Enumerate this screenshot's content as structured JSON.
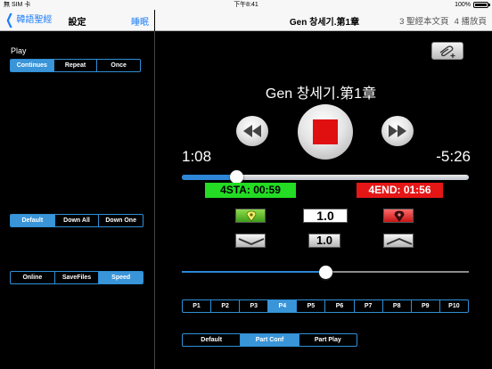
{
  "status_bar": {
    "carrier": "無 SIM 卡",
    "time": "下午8:41",
    "battery": "100%"
  },
  "nav_left": {
    "back_label": "韓語聖經",
    "title": "設定",
    "sleep_label": "睡眠"
  },
  "nav_right": {
    "title": "Gen 창세기.第1章",
    "item_text": "3 聖經本文頁",
    "item_play": "4 播放頁"
  },
  "settings": {
    "play_label": "Play",
    "play_modes": [
      "Continues",
      "Repeat",
      "Once"
    ],
    "play_selected": 0,
    "download_modes": [
      "Default",
      "Down All",
      "Down One"
    ],
    "download_selected": 0,
    "source_modes": [
      "Online",
      "SaveFiles",
      "Speed"
    ],
    "source_selected": 2
  },
  "player": {
    "song_title": "Gen 창세기.第1章",
    "elapsed": "1:08",
    "remaining": "-5:26",
    "progress_fraction": 0.19,
    "ab_start": "4STA: 00:59",
    "ab_end": "4END: 01:56",
    "rate_display": "1.0",
    "rate_button": "1.0",
    "volume_fraction": 0.5,
    "parts": [
      "P1",
      "P2",
      "P3",
      "P4",
      "P5",
      "P6",
      "P7",
      "P8",
      "P9",
      "P10"
    ],
    "part_selected": 3,
    "part_modes": [
      "Default",
      "Part Conf",
      "Part Play"
    ],
    "part_mode_selected": 1
  },
  "colors": {
    "accent": "#2f8fd6",
    "ab_start_bg": "#23dc23",
    "ab_end_bg": "#e51616",
    "stop_red": "#e01010"
  },
  "icons": {
    "back": "chevron-left-icon",
    "attach": "paperclip-plus-icon",
    "rewind": "rewind-icon",
    "stop": "stop-icon",
    "forward": "fast-forward-icon",
    "marker_start": "map-pin-green-icon",
    "marker_end": "map-pin-red-icon",
    "slower": "chevron-down-icon",
    "faster": "chevron-up-icon"
  }
}
